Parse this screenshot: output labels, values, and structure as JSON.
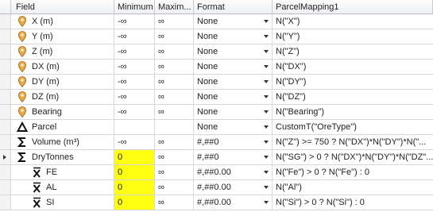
{
  "columns": [
    "Field",
    "Minimum",
    "Maxim...",
    "Format",
    "ParcelMapping1"
  ],
  "rows": [
    {
      "icon": "pin",
      "indent": 0,
      "field": "X (m)",
      "min": "-∞",
      "max": "∞",
      "format": "None",
      "mapping": "N(\"X\")",
      "current": false,
      "highlight": false
    },
    {
      "icon": "pin",
      "indent": 0,
      "field": "Y (m)",
      "min": "-∞",
      "max": "∞",
      "format": "None",
      "mapping": "N(\"Y\")",
      "current": false,
      "highlight": false
    },
    {
      "icon": "pin",
      "indent": 0,
      "field": "Z (m)",
      "min": "-∞",
      "max": "∞",
      "format": "None",
      "mapping": "N(\"Z\")",
      "current": false,
      "highlight": false
    },
    {
      "icon": "pin",
      "indent": 0,
      "field": "DX (m)",
      "min": "-∞",
      "max": "∞",
      "format": "None",
      "mapping": "N(\"DX\")",
      "current": false,
      "highlight": false
    },
    {
      "icon": "pin",
      "indent": 0,
      "field": "DY (m)",
      "min": "-∞",
      "max": "∞",
      "format": "None",
      "mapping": "N(\"DY\")",
      "current": false,
      "highlight": false
    },
    {
      "icon": "pin",
      "indent": 0,
      "field": "DZ (m)",
      "min": "-∞",
      "max": "∞",
      "format": "None",
      "mapping": "N(\"DZ\")",
      "current": false,
      "highlight": false
    },
    {
      "icon": "pin",
      "indent": 0,
      "field": "Bearing",
      "min": "-∞",
      "max": "∞",
      "format": "None",
      "mapping": "N(\"Bearing\")",
      "current": false,
      "highlight": false
    },
    {
      "icon": "delta",
      "indent": 0,
      "field": "Parcel",
      "min": "",
      "max": "",
      "format": "None",
      "mapping": "CustomT(\"OreType\")",
      "current": false,
      "highlight": false
    },
    {
      "icon": "sigma",
      "indent": 0,
      "field": "Volume (m³)",
      "min": "-∞",
      "max": "∞",
      "format": "#,##0",
      "mapping": "N(\"Z\") >= 750 ? N(\"DX\")*N(\"DY\")*N(\"...",
      "current": false,
      "highlight": false
    },
    {
      "icon": "sigma",
      "indent": 0,
      "field": "DryTonnes",
      "min": "0",
      "max": "∞",
      "format": "#,##0",
      "mapping": "N(\"SG\") > 0 ? N(\"DX\")*N(\"DY\")*N(\"DZ\"...",
      "current": true,
      "highlight": true
    },
    {
      "icon": "xbar",
      "indent": 1,
      "field": "FE",
      "min": "0",
      "max": "∞",
      "format": "#,##0.00",
      "mapping": "N(\"Fe\") > 0 ? N(\"Fe\") : 0",
      "current": false,
      "highlight": true
    },
    {
      "icon": "xbar",
      "indent": 1,
      "field": "AL",
      "min": "0",
      "max": "∞",
      "format": "#,##0.00",
      "mapping": "N(\"Al\")",
      "current": false,
      "highlight": true
    },
    {
      "icon": "xbar",
      "indent": 1,
      "field": "SI",
      "min": "0",
      "max": "∞",
      "format": "#,##0.00",
      "mapping": "N(\"Si\") > 0 ? N(\"Si\") : 0",
      "current": false,
      "highlight": true
    }
  ],
  "colors": {
    "highlight": "#ffff14",
    "pin": "#e8a23a",
    "grid": "#d8d8d8"
  }
}
